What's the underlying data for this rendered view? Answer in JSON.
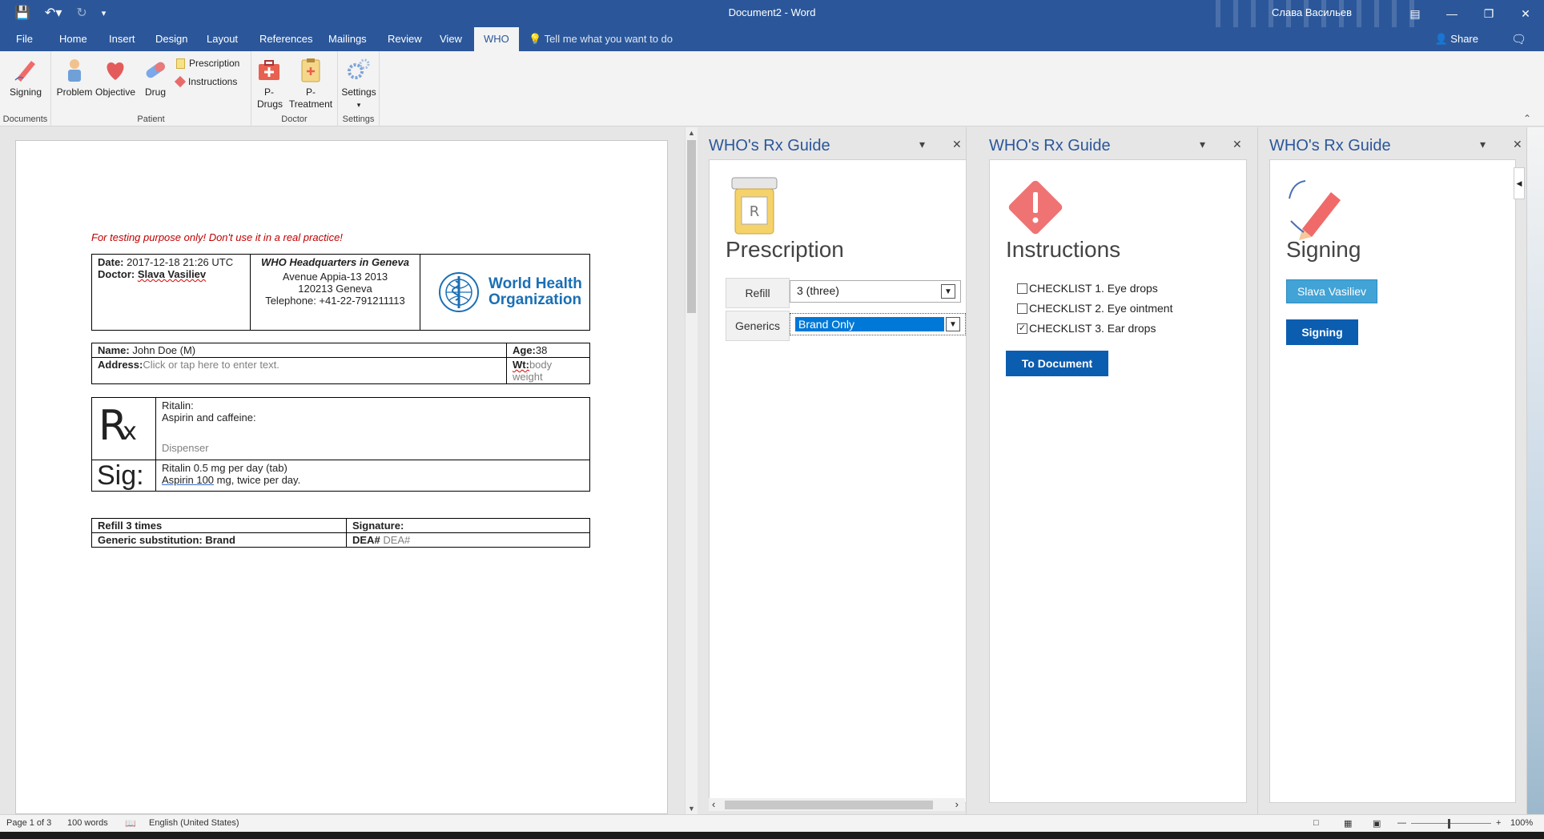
{
  "window": {
    "title": "Document2 - Word",
    "user": "Слава Васильев"
  },
  "tabs": {
    "file": "File",
    "home": "Home",
    "insert": "Insert",
    "design": "Design",
    "layout": "Layout",
    "references": "References",
    "mailings": "Mailings",
    "review": "Review",
    "view": "View",
    "who": "WHO",
    "tell": "Tell me what you want to do",
    "share": "Share"
  },
  "ribbon": {
    "signing": "Signing",
    "documents": "Documents",
    "problem": "Problem",
    "objective": "Objective",
    "drug": "Drug",
    "prescription": "Prescription",
    "instructions": "Instructions",
    "patient": "Patient",
    "pdrugs": "P-Drugs",
    "ptreatment": "P-Treatment",
    "doctor": "Doctor",
    "settings": "Settings",
    "settings_group": "Settings"
  },
  "document": {
    "warning": "For testing purpose only! Don't use it in a real practice!",
    "date_label": "Date:",
    "date_value": "2017-12-18 21:26 UTC",
    "doctor_label": "Doctor:",
    "doctor_value": "Slava Vasiliev",
    "hq_title": "WHO Headquarters in Geneva",
    "hq_line1": "Avenue Appia-13 2013",
    "hq_line2": "120213 Geneva",
    "hq_line3": "Telephone: +41-22-791211113",
    "who_logo_line1": "World Health",
    "who_logo_line2": "Organization",
    "name_label": "Name:",
    "name_value": "John Doe  (M)",
    "age_label": "Age:",
    "age_value": "38",
    "address_label": "Address:",
    "address_placeholder": "Click or tap here to enter text.",
    "wt_label": "Wt:",
    "wt_placeholder": "body weight",
    "rx_symbol": "R",
    "rx_sub": "x",
    "rx_line1": "Ritalin:",
    "rx_line2": "Aspirin and caffeine:",
    "dispenser": "Dispenser",
    "sig_label": "Sig:",
    "sig_line1": "Ritalin 0.5 mg per day (tab)",
    "sig_line2a": "Aspirin  100",
    "sig_line2b": " mg, twice per day.",
    "refill": "Refill 3 times",
    "signature_label": "Signature:",
    "generic": "Generic substitution: Brand",
    "dea_label": "DEA#",
    "dea_placeholder": "DEA#"
  },
  "panes": [
    {
      "title": "WHO's Rx Guide",
      "heading": "Prescription",
      "refill_label": "Refill",
      "refill_value": "3 (three)",
      "generics_label": "Generics",
      "generics_value": "Brand Only"
    },
    {
      "title": "WHO's Rx Guide",
      "heading": "Instructions",
      "checklist": [
        {
          "label": "CHECKLIST 1. Eye drops",
          "checked": false
        },
        {
          "label": "CHECKLIST 2. Eye ointment",
          "checked": false
        },
        {
          "label": "CHECKLIST 3. Ear drops",
          "checked": true
        }
      ],
      "button": "To Document"
    },
    {
      "title": "WHO's Rx Guide",
      "heading": "Signing",
      "user_button": "Slava Vasiliev",
      "button": "Signing"
    }
  ],
  "status": {
    "page": "Page 1 of 3",
    "words": "100 words",
    "language": "English (United States)",
    "zoom": "100%"
  }
}
